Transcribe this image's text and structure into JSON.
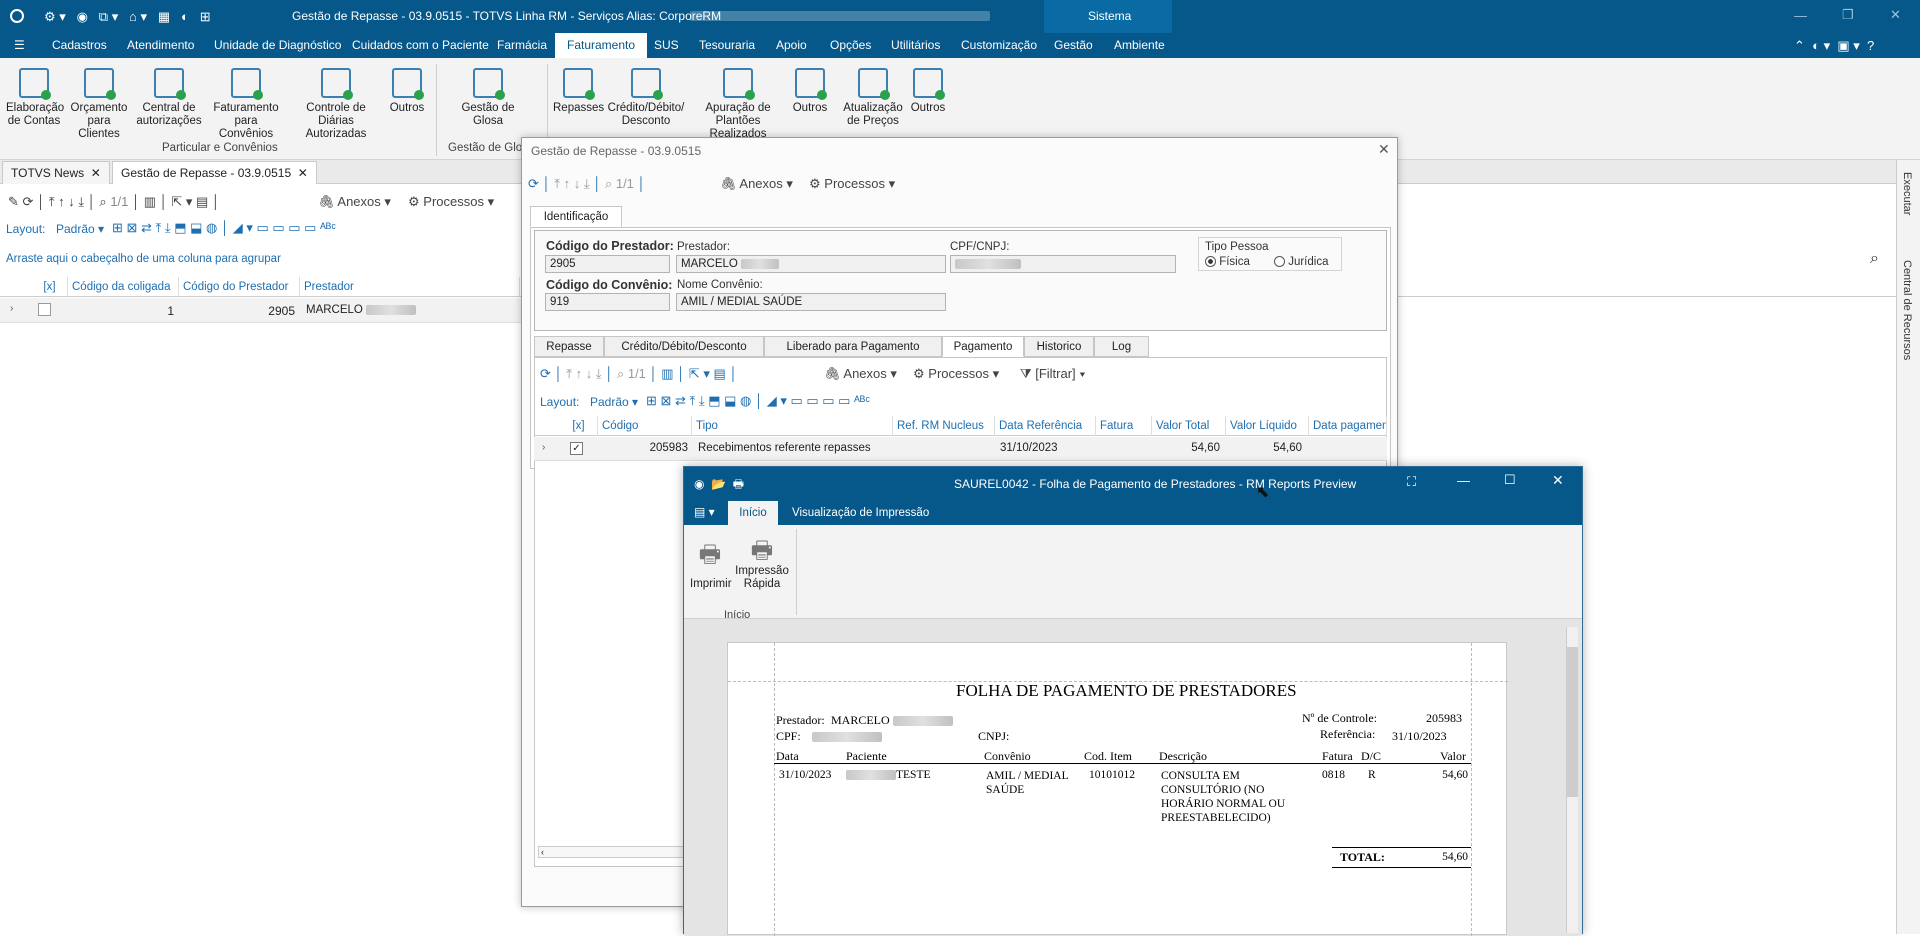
{
  "titlebar": {
    "title": "Gestão de Repasse - 03.9.0515 - TOTVS Linha RM - Serviços  Alias: CorporeRM",
    "section": "Sistema"
  },
  "menu": [
    "Cadastros",
    "Atendimento",
    "Unidade de Diagnóstico",
    "Cuidados com o Paciente",
    "Farmácia",
    "Faturamento",
    "SUS",
    "Tesouraria",
    "Apoio",
    "Opções",
    "Utilitários",
    "Customização",
    "Gestão",
    "Ambiente"
  ],
  "ribbon": {
    "buttons": [
      "Elaboração de Contas",
      "Orçamento para Clientes",
      "Central de autorizações",
      "Faturamento para Convênios",
      "Controle de Diárias Autorizadas",
      "Outros",
      "Gestão de Glosa",
      "Repasses",
      "Crédito/Débito/ Desconto",
      "Apuração de Plantões Realizados",
      "Outros",
      "Atualização de Preços",
      "Outros"
    ],
    "groups": [
      "Particular e Convênios",
      "Gestão de Glosa"
    ]
  },
  "doc_tabs": [
    "TOTVS News",
    "Gestão de Repasse - 03.9.0515"
  ],
  "main_toolbar": {
    "page": "1/1",
    "anexos": "Anexos",
    "processos": "Processos",
    "layout": "Layout:",
    "padrao": "Padrão"
  },
  "group_hint": "Arraste aqui o cabeçalho de uma coluna para agrupar",
  "main_grid": {
    "headers": [
      "[x]",
      "Código da coligada",
      "Código do Prestador",
      "Prestador"
    ],
    "row": {
      "coligada": "1",
      "prestador_code": "2905",
      "prestador": "MARCELO"
    }
  },
  "side_panel": [
    "Executar",
    "Central de Recursos"
  ],
  "dialog": {
    "title": "Gestão de Repasse - 03.9.0515",
    "page": "1/1",
    "anexos": "Anexos",
    "processos": "Processos",
    "tab": "Identificação",
    "labels": {
      "cod_prestador": "Código do Prestador:",
      "prestador": "Prestador:",
      "cpf": "CPF/CNPJ:",
      "tipo_pessoa": "Tipo Pessoa",
      "fisica": "Física",
      "juridica": "Jurídica",
      "cod_convenio": "Código do Convênio:",
      "nome_convenio": "Nome Convênio:"
    },
    "values": {
      "cod_prestador": "2905",
      "prestador": "MARCELO",
      "cod_convenio": "919",
      "nome_convenio": "AMIL / MEDIAL SAÚDE"
    },
    "inner_tabs": [
      "Repasse",
      "Crédito/Débito/Desconto",
      "Liberado para Pagamento",
      "Pagamento",
      "Historico",
      "Log"
    ],
    "sub_toolbar": {
      "page": "1/1",
      "anexos": "Anexos",
      "processos": "Processos",
      "filtrar": "[Filtrar]",
      "layout": "Layout:",
      "padrao": "Padrão"
    },
    "grid": {
      "headers": [
        "[x]",
        "Código",
        "Tipo",
        "Ref. RM Nucleus",
        "Data Referência",
        "Fatura",
        "Valor Total",
        "Valor Líquido",
        "Data pagamen"
      ],
      "row": {
        "codigo": "205983",
        "tipo": "Recebimentos referente repasses",
        "data": "31/10/2023",
        "total": "54,60",
        "liquido": "54,60"
      }
    }
  },
  "report": {
    "title": "SAUREL0042 - Folha de Pagamento de Prestadores - RM Reports Preview",
    "tabs": [
      "Início",
      "Visualização de Impressão"
    ],
    "buttons": [
      "Imprimir",
      "Impressão Rápida"
    ],
    "group": "Início",
    "paper": {
      "heading": "FOLHA DE PAGAMENTO DE PRESTADORES",
      "prestador_label": "Prestador:",
      "prestador": "MARCELO",
      "cpf_label": "CPF:",
      "cnpj_label": "CNPJ:",
      "controle_label": "Nº de Controle:",
      "controle": "205983",
      "referencia_label": "Referência:",
      "referencia": "31/10/2023",
      "cols": [
        "Data",
        "Paciente",
        "Convênio",
        "Cod. Item",
        "Descrição",
        "Fatura",
        "D/C",
        "Valor"
      ],
      "row": {
        "data": "31/10/2023",
        "paciente": "TESTE",
        "convenio": "AMIL / MEDIAL SAÚDE",
        "cod_item": "10101012",
        "descricao": "CONSULTA EM CONSULTÓRIO (NO HORÁRIO NORMAL OU PREESTABELECIDO)",
        "fatura": "0818",
        "dc": "R",
        "valor": "54,60"
      },
      "total_label": "TOTAL:",
      "total": "54,60"
    }
  }
}
